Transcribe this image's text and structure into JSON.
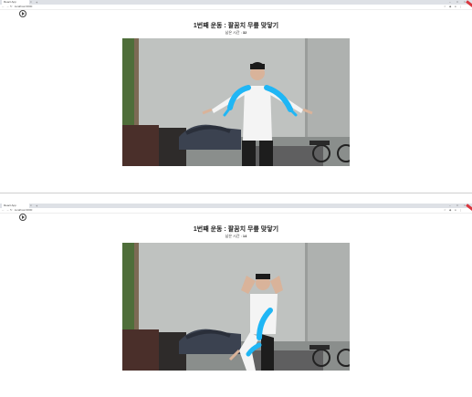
{
  "browser": {
    "tab_title": "React App",
    "tab_close_glyph": "×",
    "new_tab_glyph": "+",
    "url": "localhost:3000",
    "window_controls": [
      "–",
      "□",
      "×"
    ],
    "nav_icons": [
      "back-icon",
      "forward-icon",
      "reload-icon"
    ],
    "accent_color": "#d9363e"
  },
  "screens": [
    {
      "title": "1번째 운동 : 팔꿈치 무릎 맞닿기",
      "timer_label": "남은 시간 :",
      "timer_value": "32",
      "play_icon": "play-circle-icon"
    },
    {
      "title": "1번째 운동 : 팔꿈치 무릎 맞닿기",
      "timer_label": "남은 시간 :",
      "timer_value": "14",
      "play_icon": "play-circle-icon"
    }
  ],
  "colors": {
    "pose_overlay": "#1fb6f5",
    "background": "#ffffff"
  }
}
